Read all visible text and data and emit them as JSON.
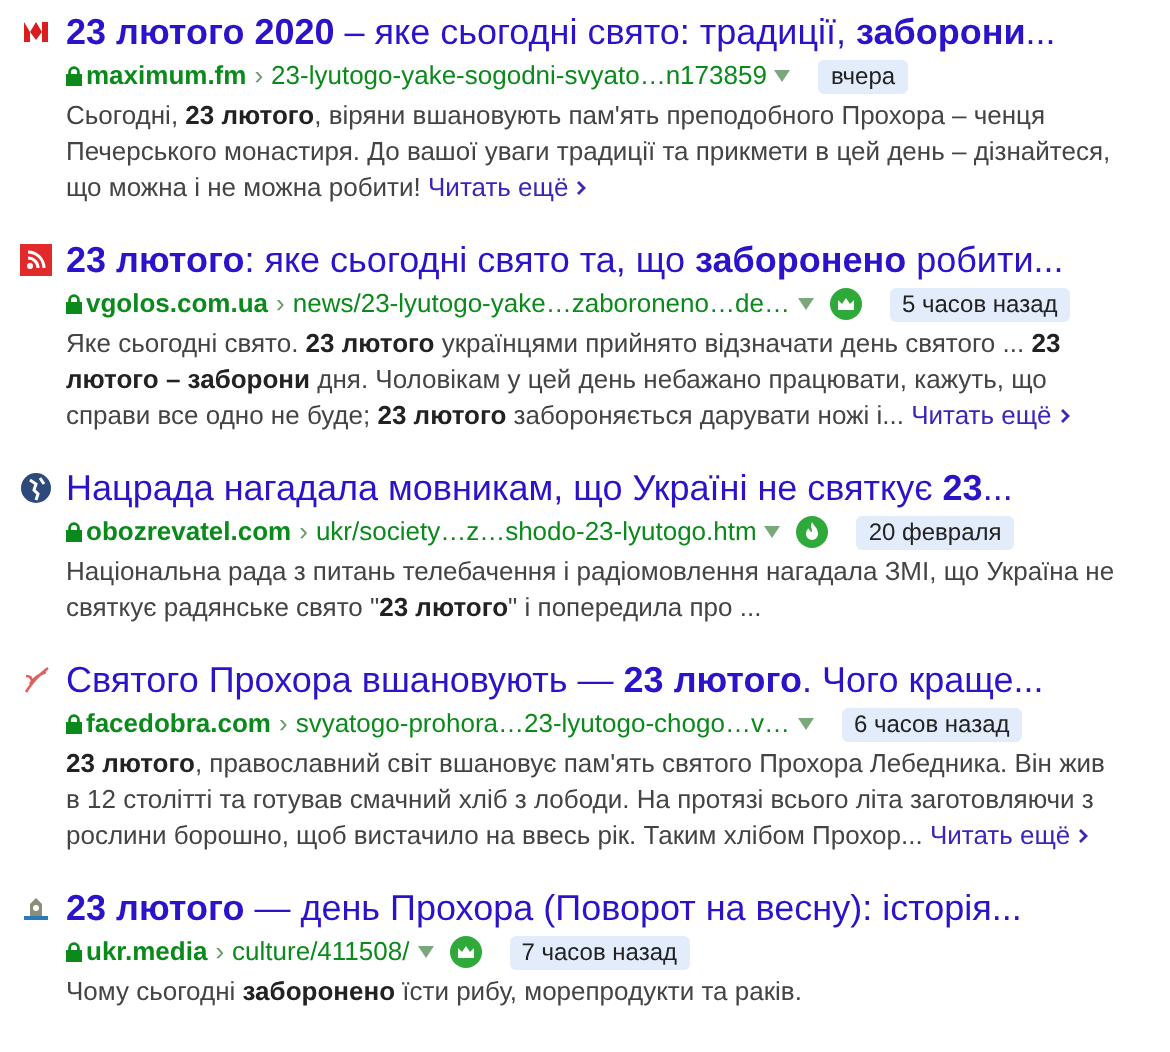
{
  "results": [
    {
      "title": "**23 лютого 2020** – яке сьогодні свято: традиції, **заборони**...",
      "domain": "maximum.fm",
      "separator": "›",
      "path": "23-lyutogo-yake-sogodni-svyato…n173859",
      "kind": "plain",
      "time": "вчера",
      "snippet": "Сьогодні, **23 лютого**, віряни вшановують пам'ять преподобного Прохора – ченця Печерського монастиря. До вашої уваги традиції та прикмети в цей день – дізнайтеся, що можна і не можна робити!",
      "more": "Читать ещё"
    },
    {
      "title": "**23 лютого**: яке сьогодні свято та, що **заборонено** робити...",
      "domain": "vgolos.com.ua",
      "separator": "›",
      "path": "news/23-lyutogo-yake…zaboroneno…de…",
      "kind": "crown",
      "time": "5 часов назад",
      "snippet": "Яке сьогодні свято. **23 лютого** українцями прийнято відзначати день святого ... **23 лютого – заборони** дня. Чоловікам у цей день небажано працювати, кажуть, що справи все одно не буде; **23 лютого** забороняється дарувати ножі і...",
      "more": "Читать ещё"
    },
    {
      "title": "Нацрада нагадала мовникам, що Україні не святкує **23**...",
      "domain": "obozrevatel.com",
      "separator": "›",
      "path": "ukr/society…z…shodo-23-lyutogo.htm",
      "kind": "flame",
      "time": "20 февраля",
      "snippet": "Національна рада з питань телебачення і радіомовлення нагадала ЗМІ, що Україна не святкує радянське свято \"**23 лютого**\" і попередила про ..."
    },
    {
      "title": "Святого Прохора вшановують — **23 лютого**. Чого краще...",
      "domain": "facedobra.com",
      "separator": "›",
      "path": "svyatogo-prohora…23-lyutogo-chogo…v…",
      "kind": "plain",
      "time": "6 часов назад",
      "snippet": "**23 лютого**, православний світ вшановує пам'ять святого Прохора Лебедника. Він жив в 12 столітті та готував смачний хліб з лободи. На протязі всього літа заготовляючи з рослини борошно, щоб вистачило на ввесь рік. Таким хлібом Прохор...",
      "more": "Читать ещё"
    },
    {
      "title": "**23 лютого** — день Прохора (Поворот на весну): історія...",
      "domain": "ukr.media",
      "separator": "›",
      "path": "culture/411508/",
      "kind": "crown",
      "time": "7 часов назад",
      "snippet": "Чому сьогодні **заборонено** їсти рибу, морепродукти та раків."
    }
  ]
}
